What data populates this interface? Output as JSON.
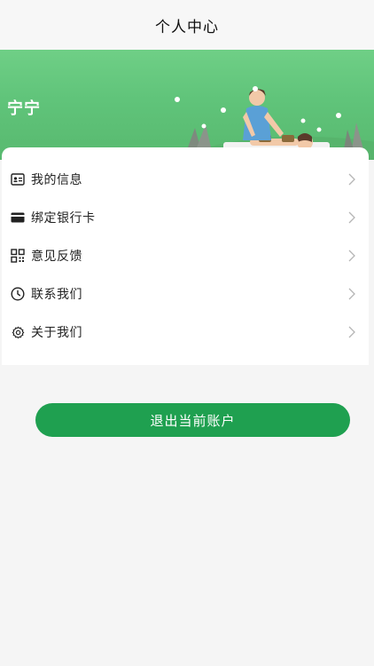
{
  "header": {
    "title": "个人中心"
  },
  "profile": {
    "username": "宁宁"
  },
  "menu": {
    "items": [
      {
        "label": "我的信息",
        "icon": "id-card-icon"
      },
      {
        "label": "绑定银行卡",
        "icon": "bank-card-icon"
      },
      {
        "label": "意见反馈",
        "icon": "qr-code-icon"
      },
      {
        "label": "联系我们",
        "icon": "clock-icon"
      },
      {
        "label": "关于我们",
        "icon": "gear-icon"
      }
    ]
  },
  "actions": {
    "logout_label": "退出当前账户"
  },
  "colors": {
    "banner": "#60c47a",
    "logout_button": "#1fa050"
  }
}
